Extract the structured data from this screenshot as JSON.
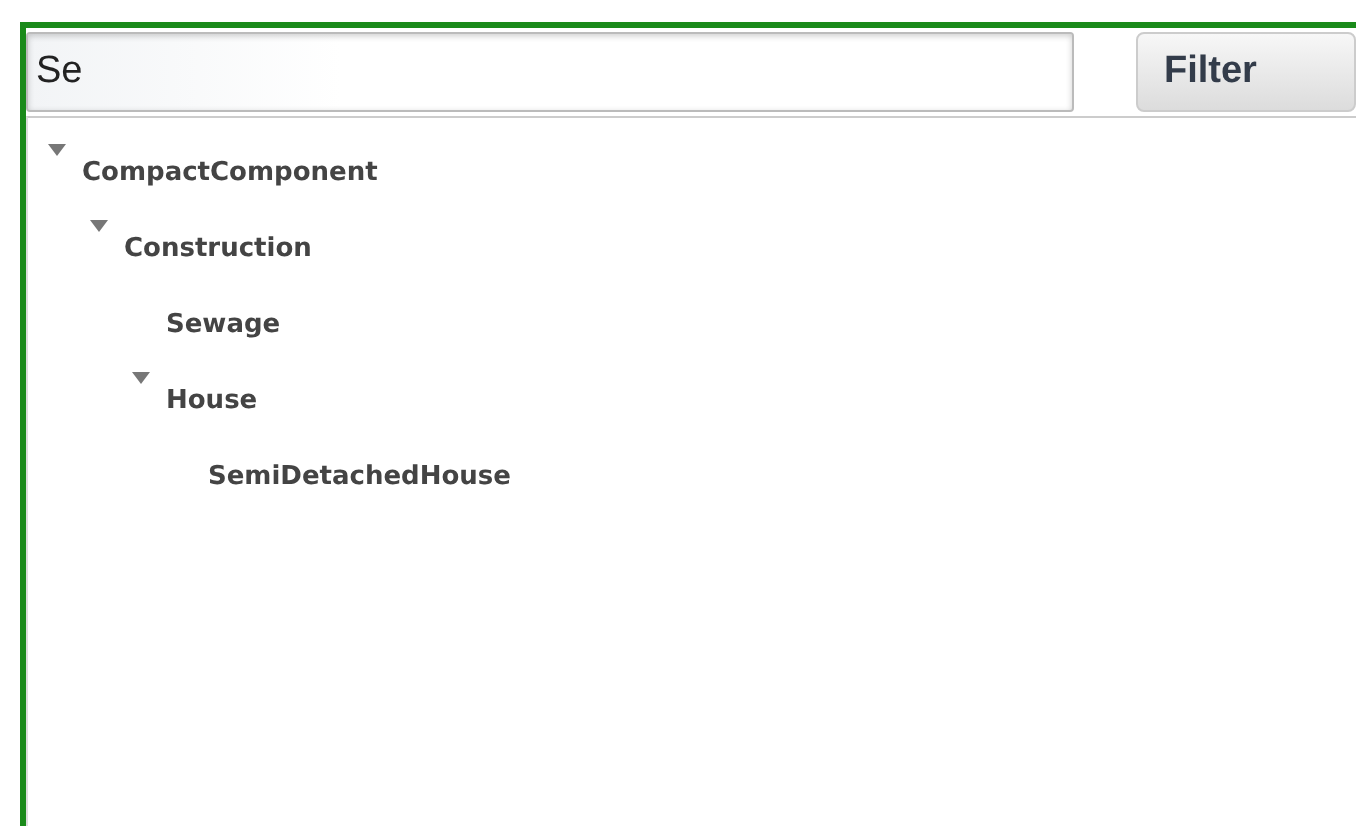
{
  "search": {
    "value": "Se"
  },
  "filter_button": {
    "label": "Filter"
  },
  "tree": [
    {
      "label": "CompactComponent",
      "expanded": true,
      "children": [
        {
          "label": "Construction",
          "expanded": true,
          "children": [
            {
              "label": "Sewage"
            },
            {
              "label": "House",
              "expanded": true,
              "children": [
                {
                  "label": "SemiDetachedHouse"
                }
              ]
            }
          ]
        }
      ]
    }
  ]
}
